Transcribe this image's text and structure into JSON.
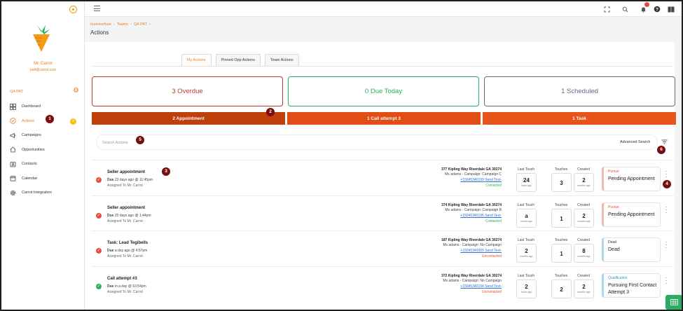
{
  "sidebar": {
    "user_name": "Mr. Carrot",
    "user_email": "patt@carrot.com",
    "company": "QA PAT",
    "items": [
      {
        "label": "Dashboard",
        "icon": "dashboard-icon"
      },
      {
        "label": "Actions",
        "icon": "check-circle-icon",
        "badge": "3",
        "active": true
      },
      {
        "label": "Campaigns",
        "icon": "megaphone-icon"
      },
      {
        "label": "Opportunities",
        "icon": "home-icon"
      },
      {
        "label": "Contacts",
        "icon": "contacts-icon"
      },
      {
        "label": "Calendar",
        "icon": "calendar-icon"
      },
      {
        "label": "Carrot Integration",
        "icon": "gear-icon"
      }
    ]
  },
  "breadcrumb": [
    "Investorfuse",
    "Teams",
    "QA PAT"
  ],
  "page_title": "Actions",
  "tabs": [
    {
      "label": "My Actions",
      "active": true
    },
    {
      "label": "Pinned Opp Actions"
    },
    {
      "label": "Team Actions"
    }
  ],
  "summary": {
    "overdue": "3 Overdue",
    "due_today": "0 Due Today",
    "scheduled": "1 Scheduled"
  },
  "types": [
    "2 Appointment",
    "1 Call attempt 3",
    "1 Task"
  ],
  "search": {
    "placeholder": "Search Actions",
    "advanced": "Advanced Search"
  },
  "stat_labels": {
    "last_touch": "Last Touch",
    "touches": "Touches",
    "created": "Created"
  },
  "rows": [
    {
      "status": "overdue",
      "title": "Seller appointment",
      "due_bold": "Due",
      "due_text": "23 days ago @ 11:45pm",
      "assigned": "Assigned To Mr. Carrot",
      "address": "377 Kipling Way Riverdale GA 30274",
      "contact": "Ms adams - Campaign: Campaign C",
      "phone": "+15045340199",
      "send_text": "Send Text-",
      "contact_status": "Contacted",
      "last_touch_num": "24",
      "last_touch_sub": "days ago",
      "touches": "3",
      "created_num": "2",
      "created_sub": "months ago",
      "stage_category": "Pursue",
      "stage": "Pending Appointment"
    },
    {
      "status": "overdue",
      "title": "Seller appointment",
      "due_bold": "Due",
      "due_text": "20 days ago @ 1:44pm",
      "assigned": "Assigned To Mr. Carrot",
      "address": "374 Kipling Way Riverdale GA 30274",
      "contact": "Ms adams - Campaign: Campaign B",
      "phone": "+15045340196",
      "send_text": "Send Text-",
      "contact_status": "Contacted",
      "last_touch_num": "a",
      "last_touch_sub": "month ago",
      "touches": "1",
      "created_num": "2",
      "created_sub": "months ago",
      "stage_category": "Pursue",
      "stage": "Pending Appointment"
    },
    {
      "status": "overdue",
      "title": "Task: Lead Tegibells",
      "due_bold": "Due",
      "due_text": "a day ago @ 4:57pm",
      "assigned": "Assigned To Mr. Carrot",
      "address": "187 Kipling Way Riverdale GA 30274",
      "contact": "Ms adams - Campaign: No Campaign",
      "phone": "+15045340009",
      "send_text": "Send Text-",
      "contact_status": "Uncontacted",
      "last_touch_num": "2",
      "last_touch_sub": "months ago",
      "touches": "1",
      "created_num": "8",
      "created_sub": "months ago",
      "stage_category": "Dead",
      "stage": "Dead"
    },
    {
      "status": "scheduled",
      "title": "Call attempt #3",
      "due_bold": "Due",
      "due_text": "in a day @ 10:54pm",
      "assigned": "Assigned To Mr. Carrot",
      "address": "372 Kipling Way Riverdale GA 30274",
      "contact": "Ms adams - Campaign: No Campaign",
      "phone": "+15045340194",
      "send_text": "Send Text-",
      "contact_status": "Uncontacted",
      "last_touch_num": "2",
      "last_touch_sub": "hours ago",
      "touches": "2",
      "created_num": "2",
      "created_sub": "months ago",
      "stage_category": "Qualification",
      "stage": "Pursuing First Contact Attempt 3"
    }
  ],
  "markers": [
    "1",
    "2",
    "3",
    "4",
    "5",
    "6"
  ],
  "colors": {
    "accent": "#e67e22",
    "overdue": "#c0392b",
    "due_today": "#27ae60",
    "scheduled": "#5d6d7e",
    "marker": "#7a0d0d"
  }
}
